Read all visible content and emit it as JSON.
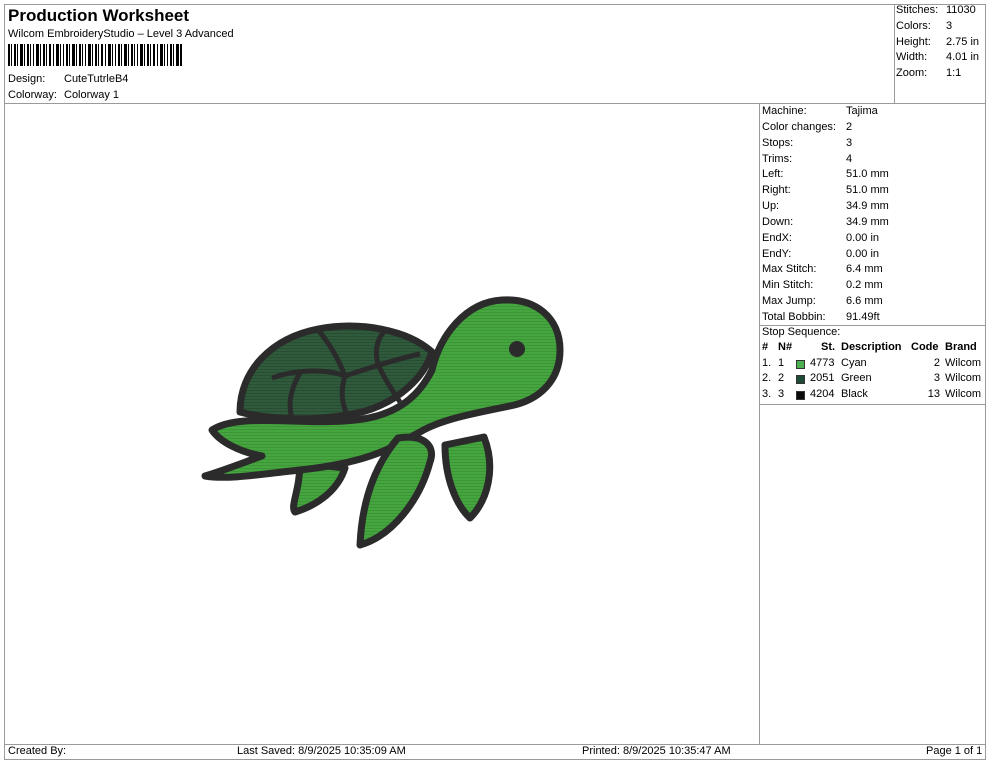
{
  "header": {
    "title": "Production Worksheet",
    "subtitle": "Wilcom EmbroideryStudio – Level 3 Advanced",
    "design_label": "Design:",
    "design_value": "CuteTutrleB4",
    "colorway_label": "Colorway:",
    "colorway_value": "Colorway 1"
  },
  "stats": [
    {
      "label": "Stitches:",
      "value": "11030"
    },
    {
      "label": "Colors:",
      "value": "3"
    },
    {
      "label": "Height:",
      "value": "2.75 in"
    },
    {
      "label": "Width:",
      "value": "4.01 in"
    },
    {
      "label": "Zoom:",
      "value": "1:1"
    }
  ],
  "machine_info": [
    {
      "label": "Machine:",
      "value": "Tajima"
    },
    {
      "label": "Color changes:",
      "value": "2"
    },
    {
      "label": "Stops:",
      "value": "3"
    },
    {
      "label": "Trims:",
      "value": "4"
    },
    {
      "label": "Left:",
      "value": "51.0 mm"
    },
    {
      "label": "Right:",
      "value": "51.0 mm"
    },
    {
      "label": "Up:",
      "value": "34.9 mm"
    },
    {
      "label": "Down:",
      "value": "34.9 mm"
    },
    {
      "label": "EndX:",
      "value": "0.00 in"
    },
    {
      "label": "EndY:",
      "value": "0.00 in"
    },
    {
      "label": "Max Stitch:",
      "value": "6.4 mm"
    },
    {
      "label": "Min Stitch:",
      "value": "0.2 mm"
    },
    {
      "label": "Max Jump:",
      "value": "6.6 mm"
    },
    {
      "label": "Total Bobbin:",
      "value": "91.49ft"
    }
  ],
  "stop_sequence": {
    "title": "Stop Sequence:",
    "headers": {
      "num": "#",
      "n": "N#",
      "st": "St.",
      "description": "Description",
      "code": "Code",
      "brand": "Brand"
    },
    "rows": [
      {
        "num": "1.",
        "n": "1",
        "color": "#4caf50",
        "st": "4773",
        "description": "Cyan",
        "code": "2",
        "brand": "Wilcom"
      },
      {
        "num": "2.",
        "n": "2",
        "color": "#1f4a37",
        "st": "2051",
        "description": "Green",
        "code": "3",
        "brand": "Wilcom"
      },
      {
        "num": "3.",
        "n": "3",
        "color": "#0a0a0a",
        "st": "4204",
        "description": "Black",
        "code": "13",
        "brand": "Wilcom"
      }
    ]
  },
  "footer": {
    "created_by": "Created By:",
    "last_saved": "Last Saved: 8/9/2025 10:35:09 AM",
    "printed": "Printed: 8/9/2025 10:35:47 AM",
    "page": "Page 1 of 1"
  },
  "colors": {
    "turtle_body": "#45a53f",
    "turtle_shell": "#2f5a3c",
    "outline": "#2b2b2b"
  }
}
